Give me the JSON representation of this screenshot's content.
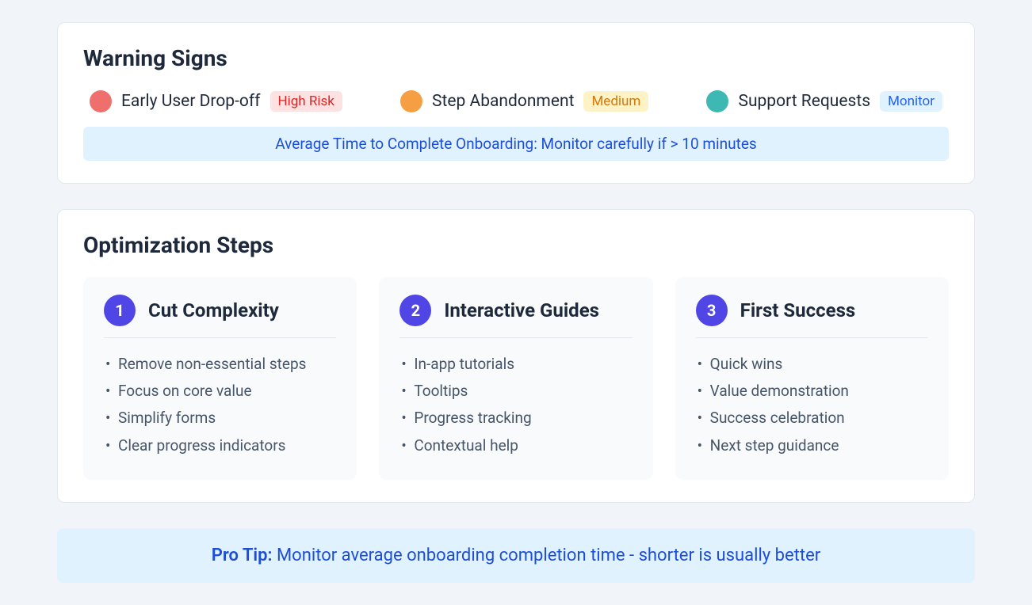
{
  "warning_signs": {
    "title": "Warning Signs",
    "items": [
      {
        "label": "Early User Drop-off",
        "badge": "High Risk",
        "dot_color": "#ef6f6c",
        "badge_class": "badge-high"
      },
      {
        "label": "Step Abandonment",
        "badge": "Medium",
        "dot_color": "#f59e42",
        "badge_class": "badge-medium"
      },
      {
        "label": "Support Requests",
        "badge": "Monitor",
        "dot_color": "#3eb8b3",
        "badge_class": "badge-monitor"
      }
    ],
    "banner": "Average Time to Complete Onboarding: Monitor carefully if > 10 minutes"
  },
  "optimization_steps": {
    "title": "Optimization Steps",
    "steps": [
      {
        "number": "1",
        "title": "Cut Complexity",
        "items": [
          "Remove non-essential steps",
          "Focus on core value",
          "Simplify forms",
          "Clear progress indicators"
        ]
      },
      {
        "number": "2",
        "title": "Interactive Guides",
        "items": [
          "In-app tutorials",
          "Tooltips",
          "Progress tracking",
          "Contextual help"
        ]
      },
      {
        "number": "3",
        "title": "First Success",
        "items": [
          "Quick wins",
          "Value demonstration",
          "Success celebration",
          "Next step guidance"
        ]
      }
    ]
  },
  "pro_tip": {
    "label": "Pro Tip:",
    "text": " Monitor average onboarding completion time - shorter is usually better"
  }
}
